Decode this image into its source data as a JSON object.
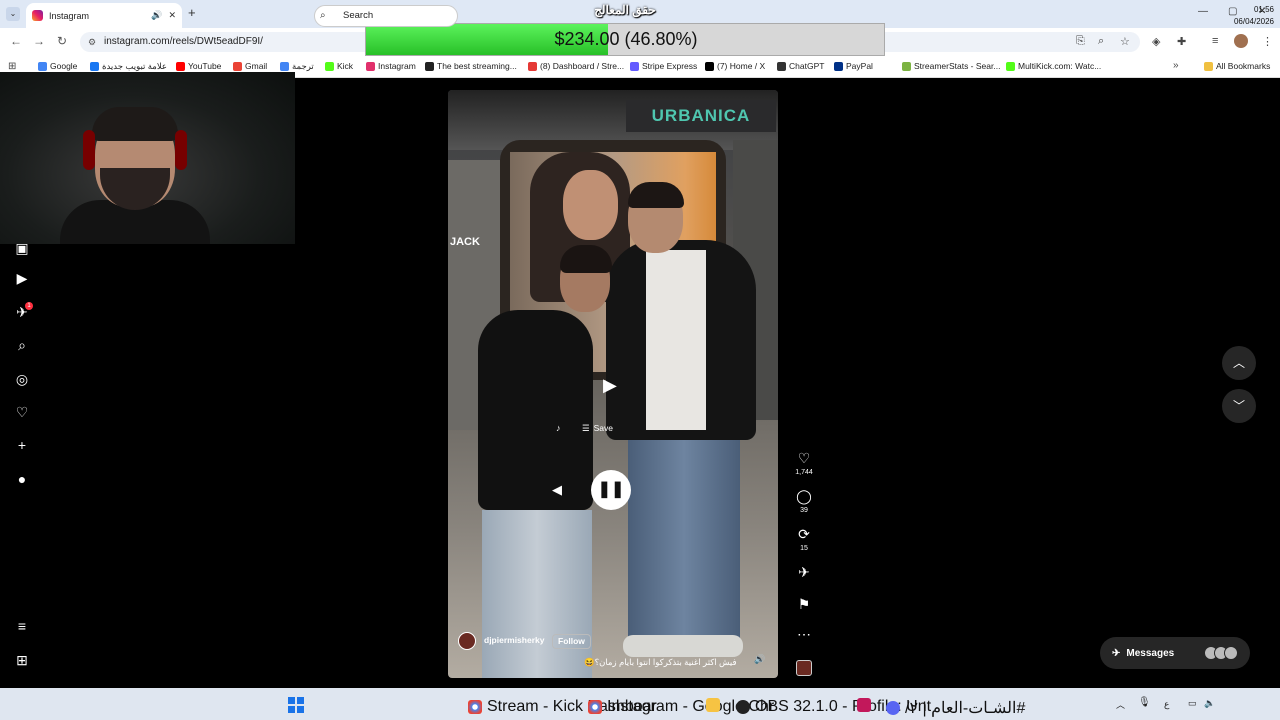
{
  "browser": {
    "tab_title": "Instagram",
    "tab_audio": "🔊",
    "tab_close": "✕",
    "new_tab": "+",
    "url": "instagram.com/reels/DWt5eadDF9I/",
    "win_min": "—",
    "win_max": "▢",
    "win_close": "✕"
  },
  "bookmarks": [
    {
      "label": "Google",
      "color": "#4285f4"
    },
    {
      "label": "علامة تبويب جديدة",
      "color": "#1877f2"
    },
    {
      "label": "YouTube",
      "color": "#ff0000"
    },
    {
      "label": "Gmail",
      "color": "#ea4335"
    },
    {
      "label": "ترجمة",
      "color": "#4285f4"
    },
    {
      "label": "Kick",
      "color": "#53fc18"
    },
    {
      "label": "Instagram",
      "color": "#e1306c"
    },
    {
      "label": "The best streaming...",
      "color": "#222"
    },
    {
      "label": "(8) Dashboard / Stre...",
      "color": "#e53935"
    },
    {
      "label": "Stripe Express",
      "color": "#635bff"
    },
    {
      "label": "(7) Home / X",
      "color": "#000"
    },
    {
      "label": "ChatGPT",
      "color": "#333"
    },
    {
      "label": "PayPal",
      "color": "#003087"
    },
    {
      "label": "StreamerStats - Sear...",
      "color": "#7cb342"
    },
    {
      "label": "MultiKick.com: Watc...",
      "color": "#53fc18"
    }
  ],
  "bookmarks_more": "»",
  "all_bookmarks": "All Bookmarks",
  "donation": {
    "title": "حقق المعالج",
    "text": "$234.00 (46.80%)",
    "progress": 0.468
  },
  "reel": {
    "store_sign": "URBANICA",
    "store_left": "JACK",
    "save_label": "Save",
    "author": "djpiermisherky",
    "follow": "Follow",
    "caption": "فيش اكثر اغنية بتذكركوا انتوا بايام زمان؟😆"
  },
  "actions": {
    "likes": "1,744",
    "comments": "39",
    "reposts": "15"
  },
  "messages": {
    "label": "Messages"
  },
  "taskbar": {
    "search": "Search",
    "items": [
      {
        "label": "Stream - Kick Dashboar"
      },
      {
        "label": "Instagram - Google Chr"
      },
      {
        "label": "OBS 32.1.0 - Profile: Unt"
      },
      {
        "label": "#الشـات-العام | ٢/"
      }
    ],
    "lang": "ع",
    "time": "01:56",
    "date": "06/04/2026"
  }
}
